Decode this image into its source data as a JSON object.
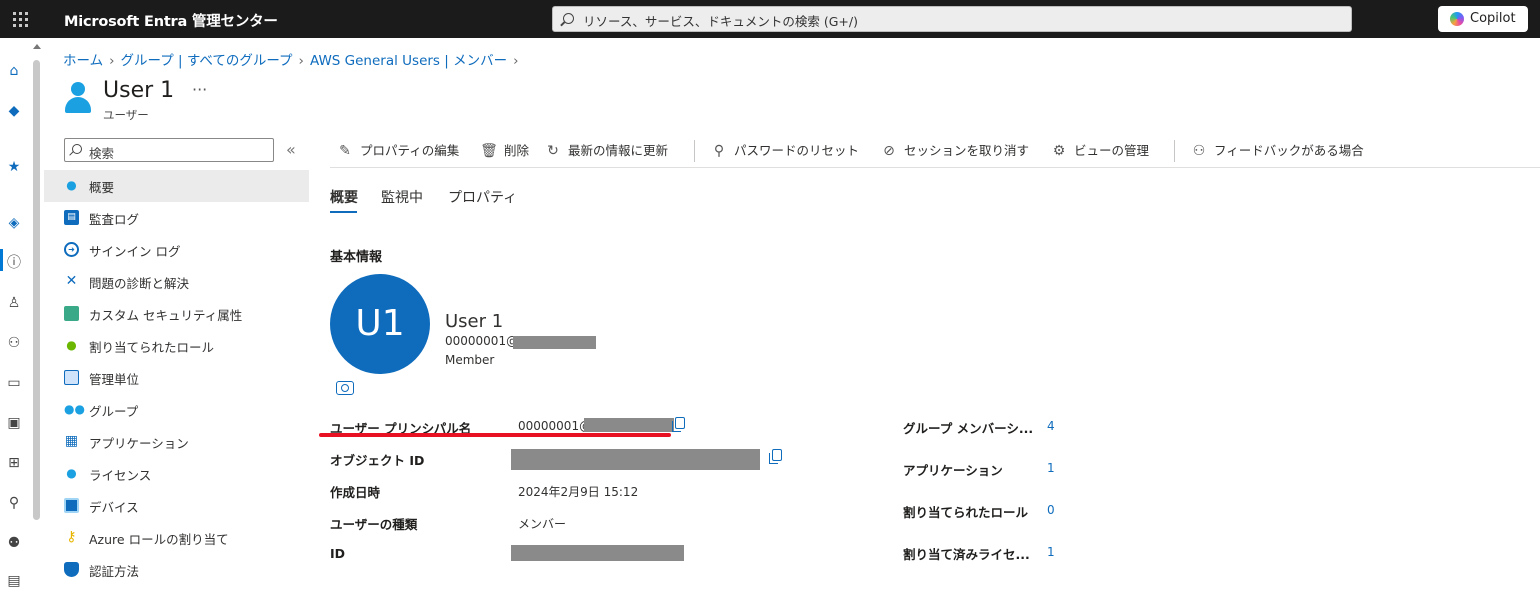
{
  "app": {
    "title": "Microsoft Entra 管理センター"
  },
  "search": {
    "placeholder": "リソース、サービス、ドキュメントの検索 (G+/)"
  },
  "copilot": {
    "label": "Copilot"
  },
  "rail": {
    "icons": [
      "home-icon",
      "dashboard-icon",
      "favorites-star-icon",
      "entra-id-icon",
      "info-icon",
      "user-icon",
      "groups-icon",
      "devices-icon",
      "applications-icon",
      "apps-grid-icon",
      "roles-icon",
      "users-admin-icon",
      "docs-icon"
    ],
    "active": "entra-id-icon"
  },
  "breadcrumb": [
    {
      "label": "ホーム"
    },
    {
      "label": "グループ | すべてのグループ"
    },
    {
      "label": "AWS General Users | メンバー"
    }
  ],
  "page": {
    "title": "User 1",
    "subtitle": "ユーザー",
    "more": "···"
  },
  "sidebar": {
    "search_placeholder": "検索",
    "collapse": "«",
    "items": [
      {
        "label": "概要",
        "icon": "user-icon",
        "active": true
      },
      {
        "label": "監査ログ",
        "icon": "audit-log-icon"
      },
      {
        "label": "サインイン ログ",
        "icon": "sign-in-log-icon"
      },
      {
        "label": "問題の診断と解決",
        "icon": "tools-icon"
      },
      {
        "label": "カスタム セキュリティ属性",
        "icon": "custom-attributes-icon"
      },
      {
        "label": "割り当てられたロール",
        "icon": "assigned-roles-icon"
      },
      {
        "label": "管理単位",
        "icon": "admin-units-icon"
      },
      {
        "label": "グループ",
        "icon": "groups-icon"
      },
      {
        "label": "アプリケーション",
        "icon": "applications-icon"
      },
      {
        "label": "ライセンス",
        "icon": "license-icon"
      },
      {
        "label": "デバイス",
        "icon": "device-icon"
      },
      {
        "label": "Azure ロールの割り当て",
        "icon": "key-icon"
      },
      {
        "label": "認証方法",
        "icon": "shield-icon"
      }
    ]
  },
  "toolbar": {
    "edit": "プロパティの編集",
    "delete": "削除",
    "refresh": "最新の情報に更新",
    "reset_password": "パスワードのリセット",
    "revoke_sessions": "セッションを取り消す",
    "manage_view": "ビューの管理",
    "feedback": "フィードバックがある場合"
  },
  "tabs": [
    {
      "label": "概要",
      "active": true
    },
    {
      "label": "監視中"
    },
    {
      "label": "プロパティ"
    }
  ],
  "basic_info": {
    "title": "基本情報",
    "initials": "U1",
    "name": "User 1",
    "upn_prefix": "00000001@",
    "member_type": "Member"
  },
  "properties": [
    {
      "label": "ユーザー プリンシパル名",
      "value": "00000001@"
    },
    {
      "label": "オブジェクト ID",
      "value": ""
    },
    {
      "label": "作成日時",
      "value": "2024年2月9日 15:12"
    },
    {
      "label": "ユーザーの種類",
      "value": "メンバー"
    },
    {
      "label": "ID",
      "value": ""
    }
  ],
  "stats": [
    {
      "label": "グループ メンバーシ...",
      "value": "4"
    },
    {
      "label": "アプリケーション",
      "value": "1"
    },
    {
      "label": "割り当てられたロール",
      "value": "0"
    },
    {
      "label": "割り当て済みライセ...",
      "value": "1"
    }
  ],
  "colors": {
    "accent": "#0f6cbd",
    "topbar": "#1b1b1b",
    "highlight": "#e81123"
  }
}
